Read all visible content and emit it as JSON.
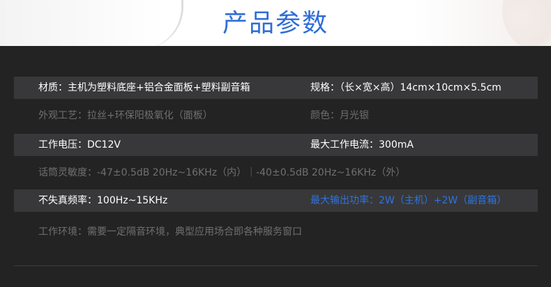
{
  "header": {
    "title": "产品参数"
  },
  "specs": {
    "material": "材质：主机为塑料底座+铝合金面板+塑料副音箱",
    "size": "规格：（长×宽×高）14cm×10cm×5.5cm",
    "process": "外观工艺：拉丝+环保阳极氧化（面板）",
    "color": "颜色：月光银",
    "voltage": "工作电压：DC12V",
    "max_current": "最大工作电流：300mA",
    "mic_sensitivity": "话筒灵敏度：-47±0.5dB 20Hz~16KHz（内）｜-40±0.5dB 20Hz~16KHz（外）",
    "undistorted_freq": "不失真频率：100Hz~15KHz",
    "max_output": "最大输出功率：2W（主机）+2W（副音箱）",
    "environment": "工作环境：需要一定隔音环境，典型应用场合即各种服务窗口"
  },
  "colors": {
    "accent": "#2f6dd6",
    "background": "#232324",
    "row_dark": "#38383a",
    "text_muted": "#6f6f70"
  }
}
